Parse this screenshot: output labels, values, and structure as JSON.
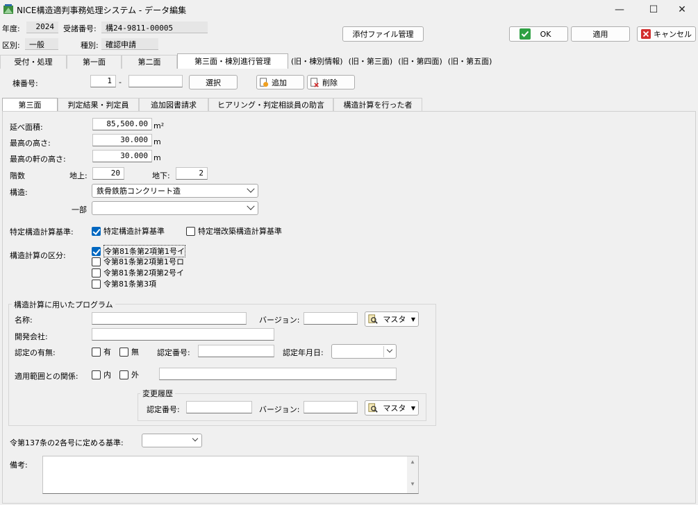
{
  "window": {
    "title": "NICE構造適判事務処理システム - データ編集",
    "minimize": "—",
    "maximize": "☐",
    "close": "✕"
  },
  "header": {
    "year_label": "年度:",
    "year_value": "2024",
    "receipt_label": "受諸番号:",
    "receipt_value": "構24-9811-00005",
    "division_label": "区別:",
    "division_value": "一般",
    "type_label": "種別:",
    "type_value": "確認申請",
    "attach_button": "添付ファイル管理",
    "ok_button": "OK",
    "apply_button": "適用",
    "cancel_button": "キャンセル"
  },
  "main_tabs": [
    "受付・処理",
    "第一面",
    "第二面",
    "第三面・棟別進行管理",
    "(旧・棟別情報)",
    "(旧・第三面)",
    "(旧・第四面)",
    "(旧・第五面)"
  ],
  "building": {
    "label": "棟番号:",
    "number": "1",
    "dash": "-",
    "sub": "",
    "select_button": "選択",
    "add_button": "追加",
    "delete_button": "削除"
  },
  "sub_tabs": [
    "第三面",
    "判定結果・判定員",
    "追加図書請求",
    "ヒアリング・判定相談員の助言",
    "構造計算を行った者"
  ],
  "form": {
    "floor_area_label": "延べ面積:",
    "floor_area_value": "85,500.00",
    "floor_area_unit": "m²",
    "max_height_label": "最高の高さ:",
    "max_height_value": "30.000",
    "max_height_unit": "m",
    "eave_height_label": "最高の軒の高さ:",
    "eave_height_value": "30.000",
    "eave_height_unit": "m",
    "floors_label": "階数",
    "above_label": "地上:",
    "above_value": "20",
    "below_label": "地下:",
    "below_value": "2",
    "structure_label": "構造:",
    "structure_value": "鉄骨鉄筋コンクリート造",
    "part_label": "一部",
    "part_value": "",
    "standard_label": "特定構造計算基準:",
    "standard_opt1": "特定構造計算基準",
    "standard_opt1_checked": true,
    "standard_opt2": "特定増改築構造計算基準",
    "standard_opt2_checked": false,
    "calc_label": "構造計算の区分:",
    "calc_options": [
      {
        "label": "令第81条第2項第1号イ",
        "checked": true
      },
      {
        "label": "令第81条第2項第1号ロ",
        "checked": false
      },
      {
        "label": "令第81条第2項第2号イ",
        "checked": false
      },
      {
        "label": "令第81条第3項",
        "checked": false
      }
    ]
  },
  "program": {
    "group_label": "構造計算に用いたプログラム",
    "name_label": "名称:",
    "version_label": "バージョン:",
    "master_button": "マスタ",
    "developer_label": "開発会社:",
    "certified_label": "認定の有無:",
    "yes_label": "有",
    "no_label": "無",
    "cert_no_label": "認定番号:",
    "cert_date_label": "認定年月日:",
    "scope_label": "適用範囲との関係:",
    "in_label": "内",
    "out_label": "外",
    "history_label": "変更履歴",
    "history_cert_label": "認定番号:",
    "history_version_label": "バージョン:",
    "history_master_button": "マスタ"
  },
  "footer": {
    "article_label": "令第137条の2各号に定める基準:",
    "remarks_label": "備考:"
  }
}
